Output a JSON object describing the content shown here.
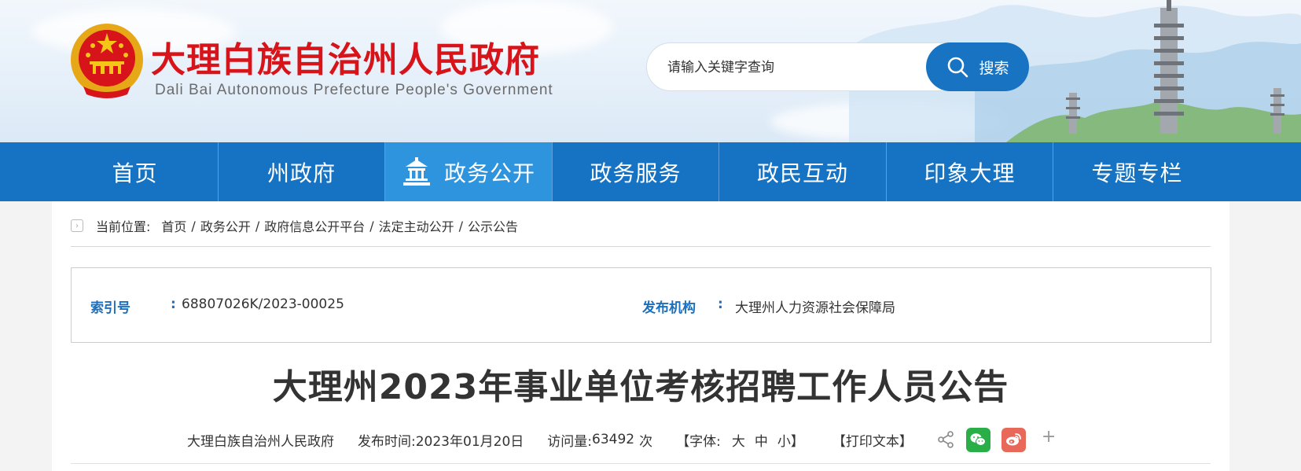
{
  "header": {
    "site_title": "大理白族自治州人民政府",
    "site_subtitle": "Dali Bai Autonomous Prefecture People's Government",
    "emblem_icon": "national-emblem-icon",
    "brand_red": "#d7141a"
  },
  "search": {
    "placeholder": "请输入关键字查询",
    "button_label": "搜索",
    "button_icon": "search-icon",
    "accent": "#1874c2"
  },
  "nav": {
    "items": [
      {
        "label": "首页"
      },
      {
        "label": "州政府"
      },
      {
        "label": "政务公开",
        "active": true,
        "icon": "building-icon"
      },
      {
        "label": "政务服务"
      },
      {
        "label": "政民互动"
      },
      {
        "label": "印象大理"
      },
      {
        "label": "专题专栏"
      }
    ],
    "color": "#1673c4",
    "active_color": "#2f94de"
  },
  "breadcrumb": {
    "label": "当前位置:",
    "items": [
      "首页",
      "政务公开",
      "政府信息公开平台",
      "法定主动公开",
      "公示公告"
    ],
    "separator": "/"
  },
  "meta": {
    "index_key": "索引号",
    "index_value": "68807026K/2023-00025",
    "publisher_key": "发布机构",
    "publisher_value": "大理州人力资源社会保障局",
    "colon": ":"
  },
  "article": {
    "title": "大理州2023年事业单位考核招聘工作人员公告",
    "source": "大理白族自治州人民政府",
    "publish_label": "发布时间:",
    "publish_date": "2023年01月20日",
    "views_label": "访问量:",
    "views_value": "63492",
    "views_unit": "次",
    "font_label": "【字体:",
    "font_large": "大",
    "font_medium": "中",
    "font_small": "小】",
    "print_label": "【打印文本】",
    "plus": "+"
  }
}
